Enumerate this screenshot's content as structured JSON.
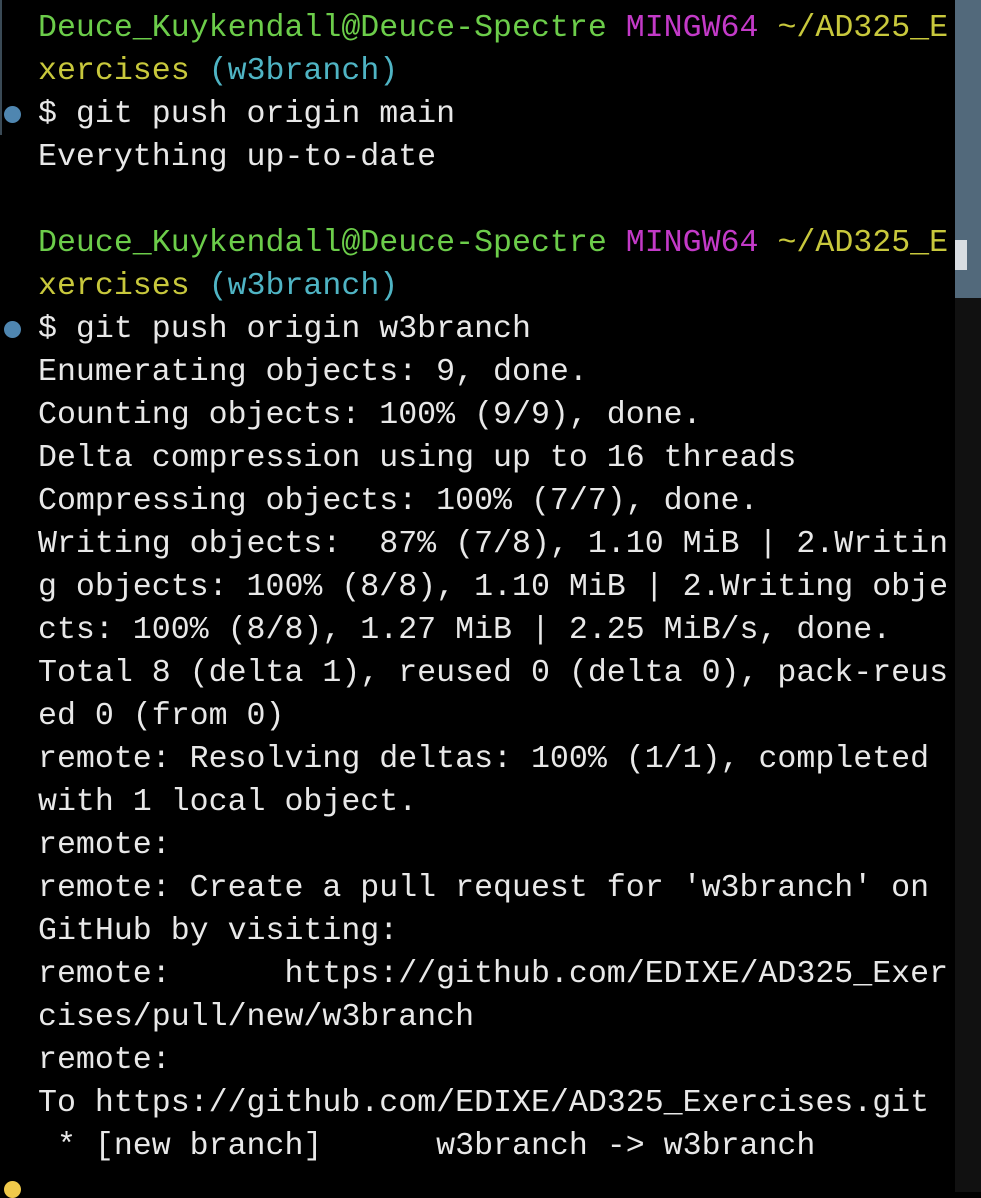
{
  "colors": {
    "user_host": "#6ccd4a",
    "msystem": "#c33ac8",
    "path": "#c8c83c",
    "branch": "#4fb4c4",
    "output": "#e8e8e8",
    "marker_done": "#4f86b0",
    "marker_current": "#f0c94a"
  },
  "lines": [
    {
      "segments": [
        {
          "text": "Deuce_Kuykendall@Deuce-Spectre ",
          "color": "user_host"
        },
        {
          "text": "MINGW64 ",
          "color": "msystem"
        },
        {
          "text": "~/AD325_E",
          "color": "path"
        }
      ]
    },
    {
      "segments": [
        {
          "text": "xercises ",
          "color": "path"
        },
        {
          "text": "(w3branch)",
          "color": "branch"
        }
      ]
    },
    {
      "marker": "marker_done",
      "segments": [
        {
          "text": "$ git push origin main",
          "color": "output"
        }
      ]
    },
    {
      "segments": [
        {
          "text": "Everything up-to-date",
          "color": "output"
        }
      ]
    },
    {
      "segments": []
    },
    {
      "segments": [
        {
          "text": "Deuce_Kuykendall@Deuce-Spectre ",
          "color": "user_host"
        },
        {
          "text": "MINGW64 ",
          "color": "msystem"
        },
        {
          "text": "~/AD325_E",
          "color": "path"
        }
      ]
    },
    {
      "segments": [
        {
          "text": "xercises ",
          "color": "path"
        },
        {
          "text": "(w3branch)",
          "color": "branch"
        }
      ]
    },
    {
      "marker": "marker_done",
      "segments": [
        {
          "text": "$ git push origin w3branch",
          "color": "output"
        }
      ]
    },
    {
      "segments": [
        {
          "text": "Enumerating objects: 9, done.",
          "color": "output"
        }
      ]
    },
    {
      "segments": [
        {
          "text": "Counting objects: 100% (9/9), done.",
          "color": "output"
        }
      ]
    },
    {
      "segments": [
        {
          "text": "Delta compression using up to 16 threads",
          "color": "output"
        }
      ]
    },
    {
      "segments": [
        {
          "text": "Compressing objects: 100% (7/7), done.",
          "color": "output"
        }
      ]
    },
    {
      "segments": [
        {
          "text": "Writing objects:  87% (7/8), 1.10 MiB | 2.Writin",
          "color": "output"
        }
      ]
    },
    {
      "segments": [
        {
          "text": "g objects: 100% (8/8), 1.10 MiB | 2.Writing obje",
          "color": "output"
        }
      ]
    },
    {
      "segments": [
        {
          "text": "cts: 100% (8/8), 1.27 MiB | 2.25 MiB/s, done.",
          "color": "output"
        }
      ]
    },
    {
      "segments": [
        {
          "text": "Total 8 (delta 1), reused 0 (delta 0), pack-reus",
          "color": "output"
        }
      ]
    },
    {
      "segments": [
        {
          "text": "ed 0 (from 0)",
          "color": "output"
        }
      ]
    },
    {
      "segments": [
        {
          "text": "remote: Resolving deltas: 100% (1/1), completed",
          "color": "output"
        }
      ]
    },
    {
      "segments": [
        {
          "text": "with 1 local object.",
          "color": "output"
        }
      ]
    },
    {
      "segments": [
        {
          "text": "remote:",
          "color": "output"
        }
      ]
    },
    {
      "segments": [
        {
          "text": "remote: Create a pull request for 'w3branch' on",
          "color": "output"
        }
      ]
    },
    {
      "segments": [
        {
          "text": "GitHub by visiting:",
          "color": "output"
        }
      ]
    },
    {
      "segments": [
        {
          "text": "remote:      https://github.com/EDIXE/AD325_Exer",
          "color": "output"
        }
      ]
    },
    {
      "segments": [
        {
          "text": "cises/pull/new/w3branch",
          "color": "output"
        }
      ]
    },
    {
      "segments": [
        {
          "text": "remote:",
          "color": "output"
        }
      ]
    },
    {
      "segments": [
        {
          "text": "To https://github.com/EDIXE/AD325_Exercises.git",
          "color": "output"
        }
      ]
    },
    {
      "segments": [
        {
          "text": " * [new branch]      w3branch -> w3branch",
          "color": "output"
        }
      ]
    },
    {
      "marker": "marker_current",
      "segments": []
    }
  ]
}
